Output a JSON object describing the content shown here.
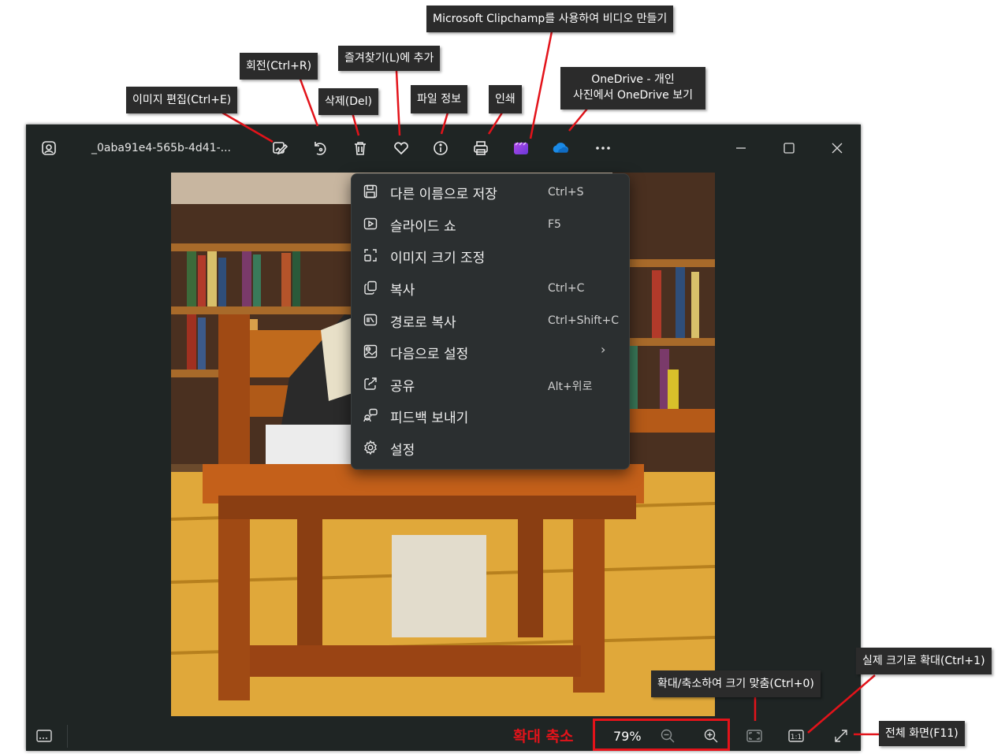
{
  "window": {
    "filename": "_0aba91e4-565b-4d41-...",
    "zoom_percent": "79%"
  },
  "toolbar": {
    "buttons": [
      {
        "name": "edit",
        "icon": "edit-image-icon"
      },
      {
        "name": "rotate",
        "icon": "rotate-icon"
      },
      {
        "name": "delete",
        "icon": "trash-icon"
      },
      {
        "name": "favorite",
        "icon": "heart-icon"
      },
      {
        "name": "info",
        "icon": "info-icon"
      },
      {
        "name": "print",
        "icon": "printer-icon"
      },
      {
        "name": "clipchamp",
        "icon": "clipchamp-icon"
      },
      {
        "name": "onedrive",
        "icon": "onedrive-cloud-icon"
      },
      {
        "name": "more",
        "icon": "more-dots-icon"
      }
    ]
  },
  "menu": {
    "items": [
      {
        "label": "다른 이름으로 저장",
        "shortcut": "Ctrl+S",
        "icon": "save-icon"
      },
      {
        "label": "슬라이드 쇼",
        "shortcut": "F5",
        "icon": "slideshow-icon"
      },
      {
        "label": "이미지 크기 조정",
        "shortcut": "",
        "icon": "resize-image-icon"
      },
      {
        "label": "복사",
        "shortcut": "Ctrl+C",
        "icon": "copy-icon"
      },
      {
        "label": "경로로 복사",
        "shortcut": "Ctrl+Shift+C",
        "icon": "copy-path-icon"
      },
      {
        "label": "다음으로 설정",
        "shortcut": "",
        "icon": "set-as-icon",
        "submenu_arrow": "›"
      },
      {
        "label": "공유",
        "shortcut": "Alt+위로",
        "icon": "share-icon"
      },
      {
        "label": "피드백 보내기",
        "shortcut": "",
        "icon": "feedback-icon"
      },
      {
        "label": "설정",
        "shortcut": "",
        "icon": "settings-icon"
      }
    ]
  },
  "callouts": {
    "edit": "이미지 편집(Ctrl+E)",
    "rotate": "회전(Ctrl+R)",
    "delete": "삭제(Del)",
    "favorite": "즐겨찾기(L)에 추가",
    "info": "파일 정보",
    "print": "인쇄",
    "clipchamp": "Microsoft Clipchamp를 사용하여 비디오 만들기",
    "onedrive_line1": "OneDrive - 개인",
    "onedrive_line2": "사진에서 OneDrive 보기",
    "fit": "확대/축소하여 크기 맞춤(Ctrl+0)",
    "actual": "실제 크기로 확대(Ctrl+1)",
    "fullscreen": "전체 화면(F11)",
    "zoom_label": "확대 축소"
  },
  "colors": {
    "window_bg": "#1f2524",
    "menu_bg": "#2b2f30",
    "annotation_red": "#e3131a",
    "callout_bg": "#2b2b2b",
    "onedrive_blue": "#1a8ae6"
  }
}
